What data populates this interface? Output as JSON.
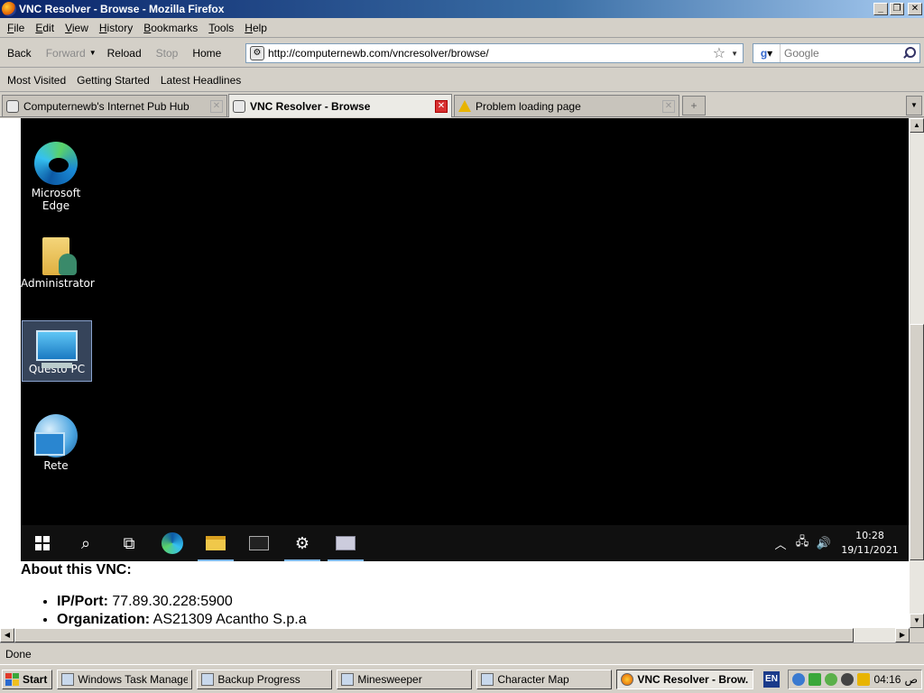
{
  "window": {
    "title": "VNC Resolver - Browse - Mozilla Firefox"
  },
  "menu": [
    {
      "key": "F",
      "rest": "ile"
    },
    {
      "key": "E",
      "rest": "dit"
    },
    {
      "key": "V",
      "rest": "iew"
    },
    {
      "key": "H",
      "rest": "istory"
    },
    {
      "key": "B",
      "rest": "ookmarks"
    },
    {
      "key": "T",
      "rest": "ools"
    },
    {
      "key": "H",
      "rest": "elp"
    }
  ],
  "nav": {
    "back": "Back",
    "forward": "Forward",
    "reload": "Reload",
    "stop": "Stop",
    "home": "Home",
    "url": "http://computernewb.com/vncresolver/browse/",
    "search_placeholder": "Google"
  },
  "bookmarks": [
    "Most Visited",
    "Getting Started",
    "Latest Headlines"
  ],
  "tabs": [
    {
      "label": "Computernewb's Internet Pub Hub"
    },
    {
      "label": "VNC Resolver - Browse"
    },
    {
      "label": "Problem loading page"
    }
  ],
  "vnc": {
    "desktop_icons": [
      "Microsoft Edge",
      "Administrator",
      "Questo PC",
      "Rete"
    ],
    "clock_time": "10:28",
    "clock_date": "19/11/2021"
  },
  "about": {
    "heading": "About this VNC:",
    "ip_label": "IP/Port:",
    "ip_value": "77.89.30.228:5900",
    "org_label": "Organization:",
    "org_value": "AS21309 Acantho S.p.a"
  },
  "status": "Done",
  "taskbar": {
    "start": "Start",
    "items": [
      "Windows Task Manager",
      "Backup Progress",
      "Minesweeper",
      "Character Map",
      "VNC Resolver - Brow..."
    ],
    "lang": "EN",
    "time": "04:16",
    "ampm": "ص"
  }
}
